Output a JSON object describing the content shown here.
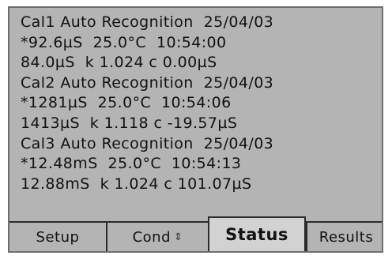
{
  "records": [
    {
      "header": "Cal1 Auto Recognition  25/04/03",
      "measured": "*92.6µS  25.0°C  10:54:00",
      "calibration": "84.0µS  k 1.024 c 0.00µS"
    },
    {
      "header": "Cal2 Auto Recognition  25/04/03",
      "measured": "*1281µS  25.0°C  10:54:06",
      "calibration": "1413µS  k 1.118 c -19.57µS"
    },
    {
      "header": "Cal3 Auto Recognition  25/04/03",
      "measured": "*12.48mS  25.0°C  10:54:13",
      "calibration": "12.88mS  k 1.024 c 101.07µS"
    }
  ],
  "tabs": {
    "setup": "Setup",
    "cond": "Cond",
    "cond_icon": "up-down-arrow-icon",
    "status": "Status",
    "results": "Results",
    "active": "status"
  },
  "colors": {
    "screen_background": "#b4b4b4",
    "text": "#111111",
    "border": "#2a2a2a"
  }
}
